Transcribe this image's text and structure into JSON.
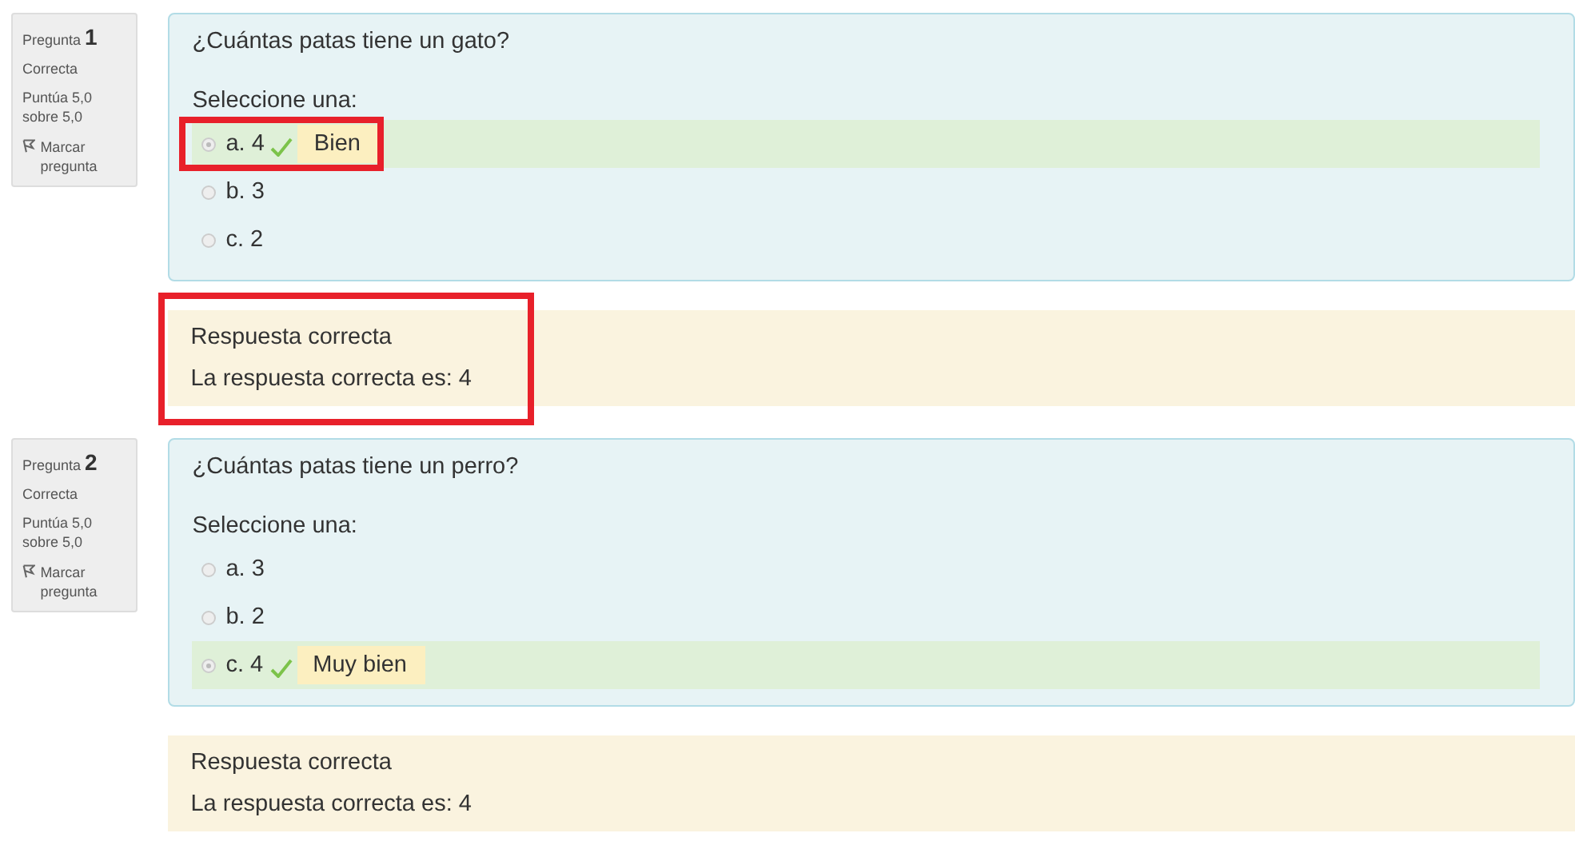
{
  "questions": [
    {
      "label": "Pregunta",
      "number": "1",
      "state": "Correcta",
      "grade": "Puntúa 5,0 sobre 5,0",
      "flag": "Marcar pregunta",
      "text": "¿Cuántas patas tiene un gato?",
      "prompt": "Seleccione una:",
      "options": [
        {
          "label": "a. 4",
          "selected": true,
          "correct": true,
          "feedback": "Bien",
          "highlighted": true
        },
        {
          "label": "b. 3",
          "selected": false,
          "correct": false,
          "highlighted": false
        },
        {
          "label": "c. 2",
          "selected": false,
          "correct": false,
          "highlighted": false
        }
      ],
      "outcome": {
        "status": "Respuesta correcta",
        "right_answer": "La respuesta correcta es: 4",
        "highlighted": true
      }
    },
    {
      "label": "Pregunta",
      "number": "2",
      "state": "Correcta",
      "grade": "Puntúa 5,0 sobre 5,0",
      "flag": "Marcar pregunta",
      "text": "¿Cuántas patas tiene un perro?",
      "prompt": "Seleccione una:",
      "options": [
        {
          "label": "a. 3",
          "selected": false,
          "correct": false,
          "highlighted": false
        },
        {
          "label": "b. 2",
          "selected": false,
          "correct": false,
          "highlighted": false
        },
        {
          "label": "c. 4",
          "selected": true,
          "correct": true,
          "feedback": "Muy bien",
          "highlighted": false
        }
      ],
      "outcome": {
        "status": "Respuesta correcta",
        "right_answer": "La respuesta correcta es: 4",
        "highlighted": false
      }
    }
  ]
}
